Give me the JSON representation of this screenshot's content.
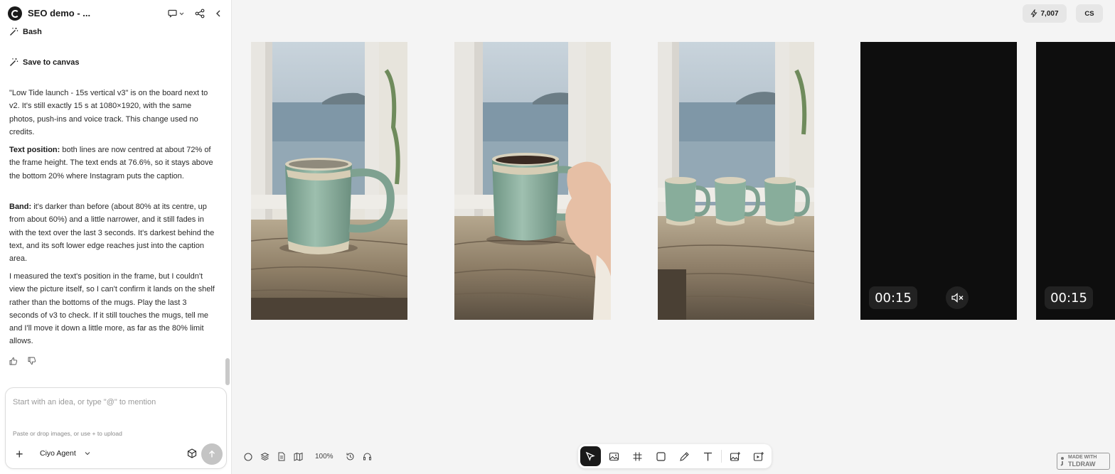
{
  "header": {
    "project_title": "SEO demo - ..."
  },
  "chat": {
    "tool_calls": [
      {
        "label": "Bash",
        "icon": "magic-wand-icon"
      },
      {
        "label": "Save to canvas",
        "icon": "magic-wand-icon"
      }
    ],
    "paragraph1": "\"Low Tide launch - 15s vertical v3\" is on the board next to v2. It's still exactly 15 s at 1080×1920, with the same photos, push-ins and voice track. This change used no credits.",
    "paragraph2_bold": "Text position:",
    "paragraph2": " both lines are now centred at about 72% of the frame height. The text ends at 76.6%, so it stays above the bottom 20% where Instagram puts the caption.",
    "paragraph3_bold": "Band:",
    "paragraph3": " it's darker than before (about 80% at its centre, up from about 60%) and a little narrower, and it still fades in with the text over the last 3 seconds. It's darkest behind the text, and its soft lower edge reaches just into the caption area.",
    "paragraph4": "I measured the text's position in the frame, but I couldn't view the picture itself, so I can't confirm it lands on the shelf rather than the bottoms of the mugs. Play the last 3 seconds of v3 to check. If it still touches the mugs, tell me and I'll move it down a little more, as far as the 80% limit allows."
  },
  "composer": {
    "placeholder": "Start with an idea, or type \"@\" to mention",
    "hint": "Paste or drop images, or use + to upload",
    "agent": "Ciyo Agent",
    "plus": "+"
  },
  "topbar": {
    "credits": "7,007",
    "user_initials": "CS"
  },
  "canvas": {
    "videos": [
      {
        "duration": "00:15",
        "muted": true
      },
      {
        "duration": "00:15"
      }
    ]
  },
  "bottom": {
    "zoom": "100%",
    "tldraw_line1": "MADE WITH",
    "tldraw_line2": "TLDRAW"
  },
  "toolbar": {
    "tools": [
      "select-tool",
      "image-tool",
      "frame-tool",
      "rectangle-tool",
      "pencil-tool",
      "text-tool",
      "add-image-tool",
      "add-video-tool"
    ],
    "active": "select-tool"
  }
}
